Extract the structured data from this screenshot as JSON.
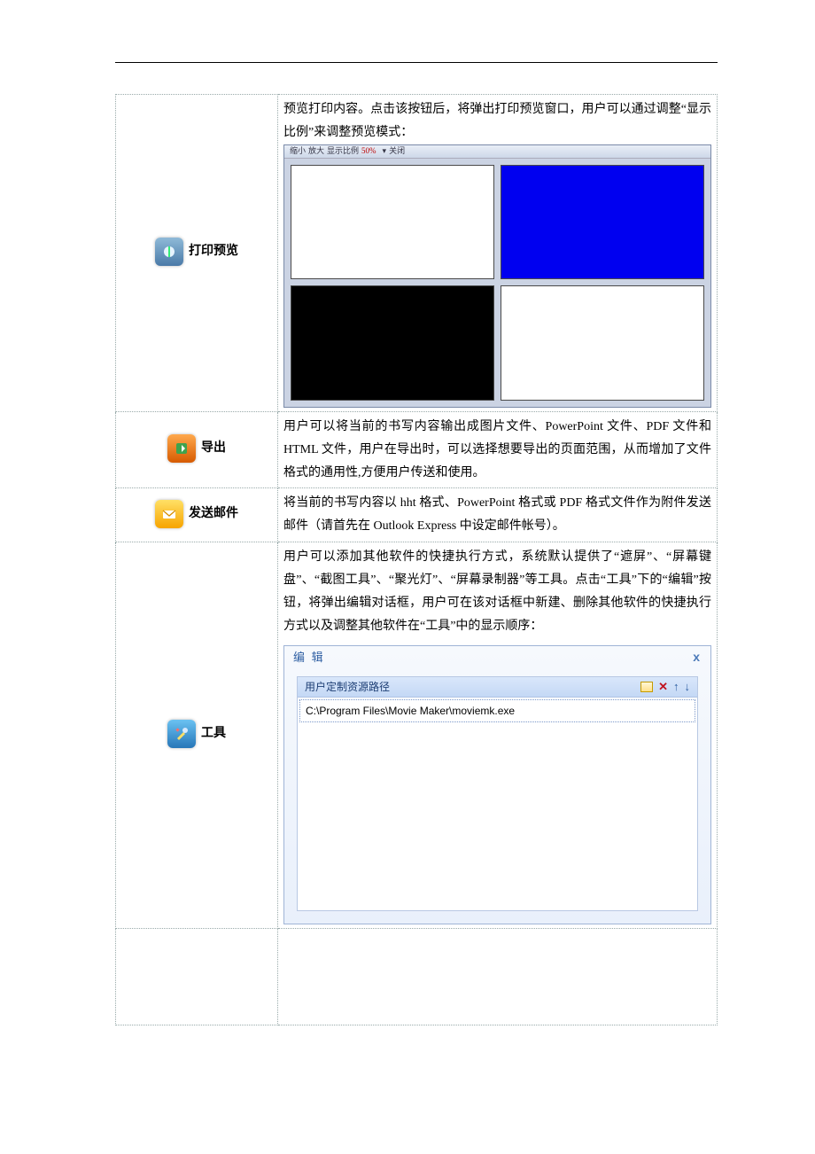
{
  "rows": [
    {
      "icon": "print-preview-icon",
      "label": "打印预览",
      "desc": "预览打印内容。点击该按钮后，将弹出打印预览窗口，用户可以通过调整“显示比例”来调整预览模式：",
      "preview_toolbar": {
        "shrink": "缩小",
        "zoomout": "放大",
        "ratio_label": "显示比例",
        "ratio_value": "50%",
        "close": "关闭"
      }
    },
    {
      "icon": "export-icon",
      "label": "导出",
      "desc": "用户可以将当前的书写内容输出成图片文件、PowerPoint 文件、PDF 文件和 HTML 文件，用户在导出时，可以选择想要导出的页面范围，从而增加了文件格式的通用性,方便用户传送和使用。"
    },
    {
      "icon": "send-mail-icon",
      "label": "发送邮件",
      "desc": "将当前的书写内容以 hht 格式、PowerPoint 格式或 PDF 格式文件作为附件发送邮件（请首先在 Outlook Express 中设定邮件帐号）。"
    },
    {
      "icon": "tools-icon",
      "label": "工具",
      "desc": "用户可以添加其他软件的快捷执行方式，系统默认提供了“遮屏”、“屏幕键盘”、“截图工具”、“聚光灯”、“屏幕录制器”等工具。点击“工具”下的“编辑”按钮，将弹出编辑对话框，用户可在该对话框中新建、删除其他软件的快捷执行方式以及调整其他软件在“工具”中的显示顺序：",
      "dialog": {
        "title": "编 辑",
        "section": "用户定制资源路径",
        "path": "C:\\Program Files\\Movie Maker\\moviemk.exe"
      }
    }
  ]
}
